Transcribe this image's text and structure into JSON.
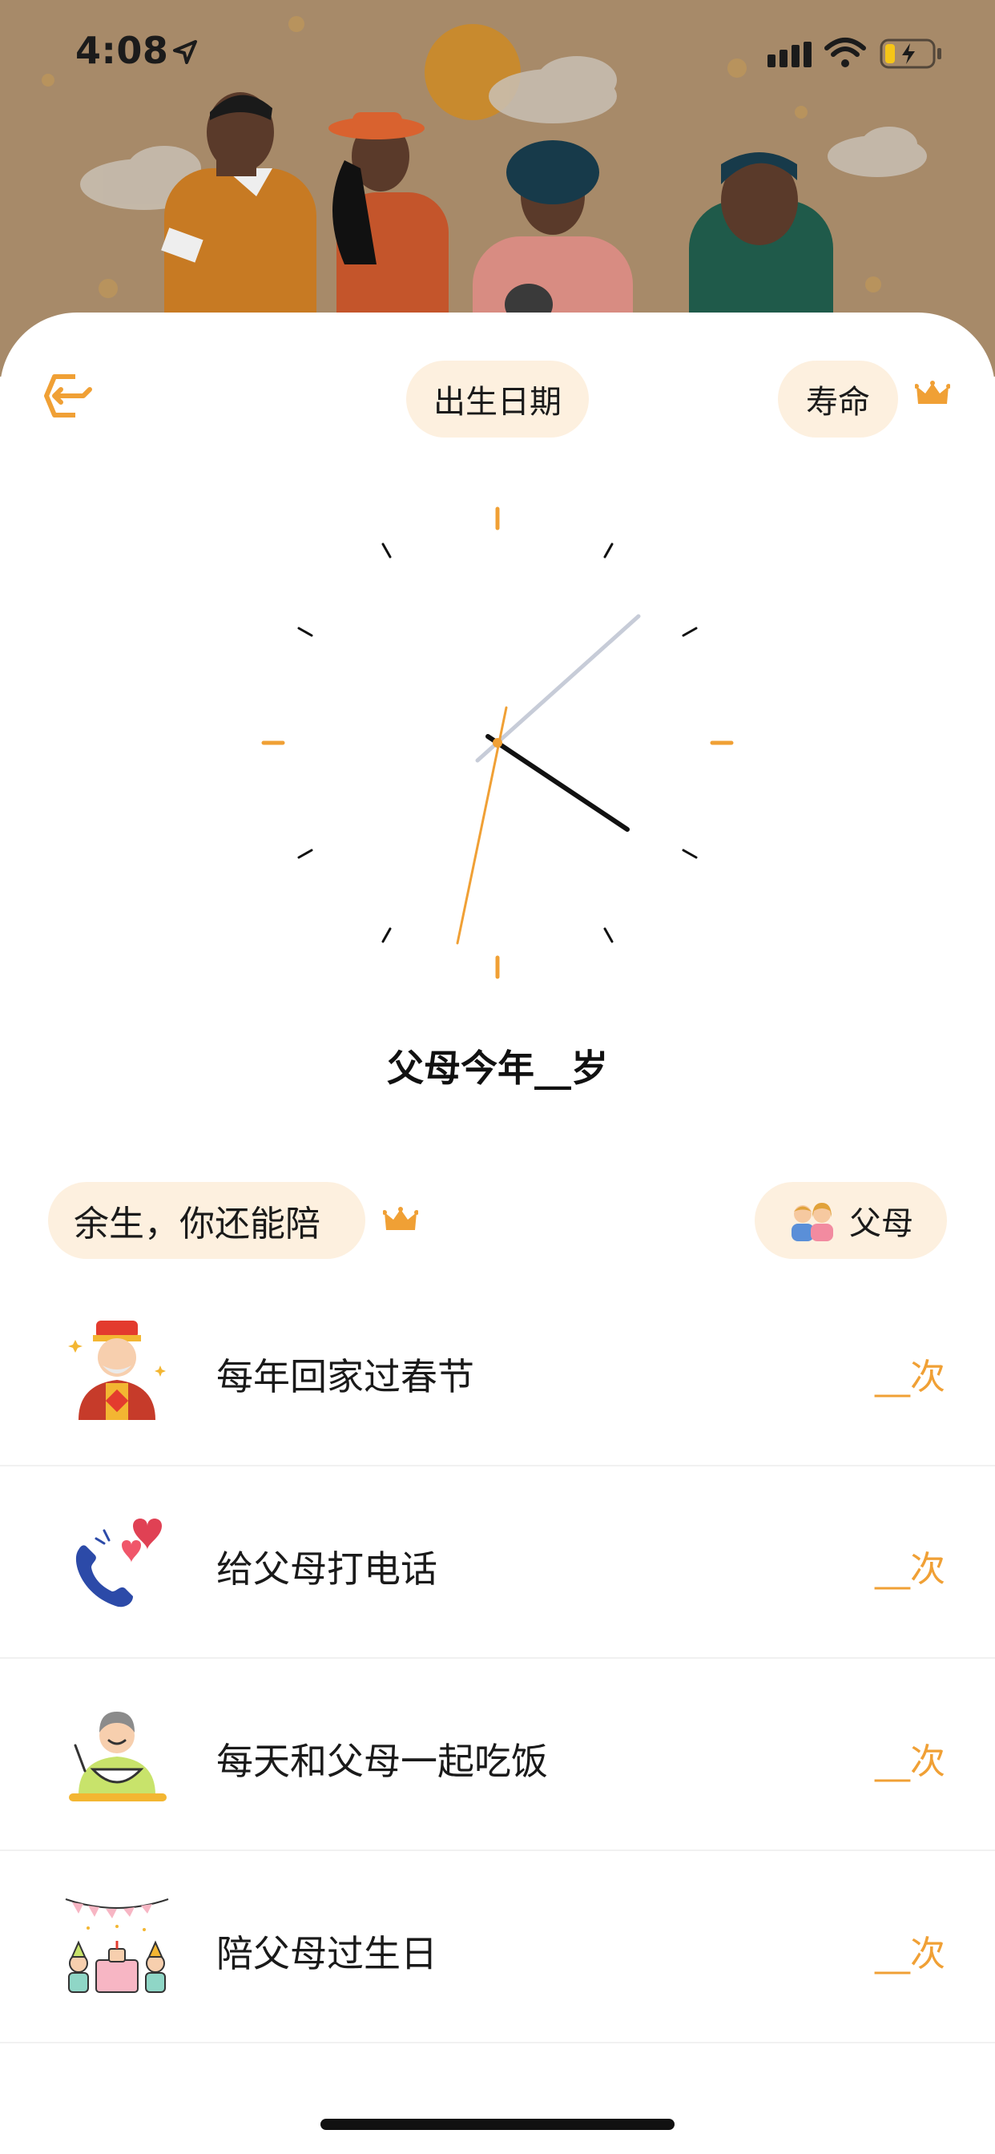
{
  "status_bar": {
    "time": "4:08",
    "battery_color": "#f5c518"
  },
  "header": {
    "birth_date_label": "出生日期",
    "lifespan_label": "寿命"
  },
  "clock": {
    "accent_color": "#f0a035"
  },
  "age_title": "父母今年__岁",
  "remaining": {
    "label": "余生，你还能陪",
    "target_label": "父母"
  },
  "activities": [
    {
      "label": "每年回家过春节",
      "count": "__次",
      "icon": "god-of-wealth-icon"
    },
    {
      "label": "给父母打电话",
      "count": "__次",
      "icon": "phone-hearts-icon"
    },
    {
      "label": "每天和父母一起吃饭",
      "count": "__次",
      "icon": "eating-meal-icon"
    },
    {
      "label": "陪父母过生日",
      "count": "__次",
      "icon": "birthday-party-icon"
    }
  ],
  "colors": {
    "accent": "#f0a035",
    "pill_bg": "#fdf0df"
  }
}
